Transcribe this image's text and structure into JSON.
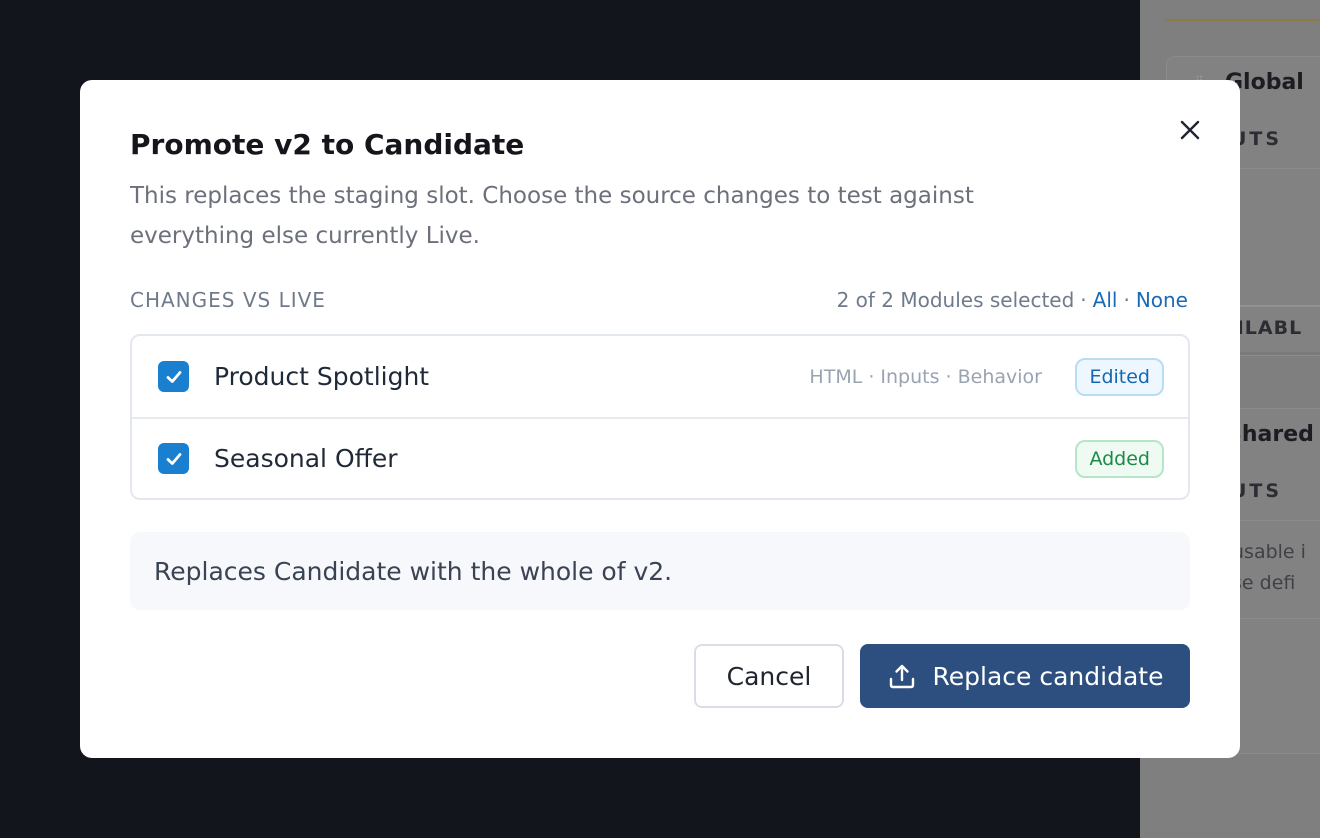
{
  "background": {
    "card1_title": "Global",
    "card1_section": "UTS",
    "tab_label": "AILABL",
    "card2_title": "Shared",
    "card2_section": "UTS",
    "note_line1": "usable i",
    "note_line2": "se defi"
  },
  "modal": {
    "title": "Promote v2 to Candidate",
    "description": "This replaces the staging slot. Choose the source changes to test against everything else currently Live.",
    "changes_label": "CHANGES VS LIVE",
    "selection_count": "2 of 2 Modules selected",
    "separator": "·",
    "select_all": "All",
    "select_none": "None",
    "items": [
      {
        "name": "Product Spotlight",
        "meta": "HTML · Inputs · Behavior",
        "badge": "Edited",
        "checked": true
      },
      {
        "name": "Seasonal Offer",
        "meta": "",
        "badge": "Added",
        "checked": true
      }
    ],
    "summary": "Replaces Candidate with the whole of v2.",
    "cancel_label": "Cancel",
    "confirm_label": "Replace candidate"
  },
  "colors": {
    "primary": "#2c4f80",
    "checkbox": "#1a7fcf",
    "edited": "#1467b0",
    "added": "#1c8a47"
  }
}
